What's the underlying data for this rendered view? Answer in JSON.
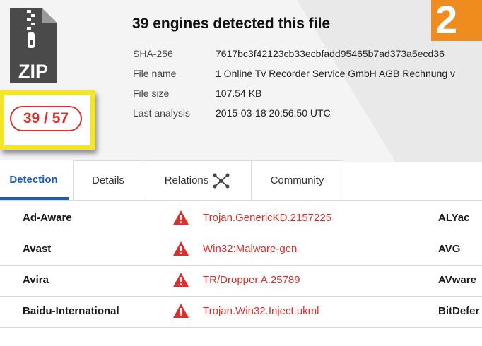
{
  "corner_number": "2",
  "file_icon": {
    "type": "ZIP"
  },
  "score": "39 / 57",
  "summary": {
    "title": "39 engines detected this file",
    "fields": [
      {
        "label": "SHA-256",
        "value": "7617bc3f42123cb33ecbfadd95465b7ad373a5ecd36"
      },
      {
        "label": "File name",
        "value": "1 Online Tv Recorder Service GmbH AGB Rechnung v"
      },
      {
        "label": "File size",
        "value": "107.54 KB"
      },
      {
        "label": "Last analysis",
        "value": "2015-03-18 20:56:50 UTC"
      }
    ]
  },
  "tabs": [
    {
      "label": "Detection",
      "active": true
    },
    {
      "label": "Details"
    },
    {
      "label": "Relations",
      "icon": "graph-icon"
    },
    {
      "label": "Community"
    }
  ],
  "detections": [
    {
      "engine": "Ad-Aware",
      "result": "Trojan.GenericKD.2157225",
      "engine2": "ALYac"
    },
    {
      "engine": "Avast",
      "result": "Win32:Malware-gen",
      "engine2": "AVG"
    },
    {
      "engine": "Avira",
      "result": "TR/Dropper.A.25789",
      "engine2": "AVware"
    },
    {
      "engine": "Baidu-International",
      "result": "Trojan.Win32.Inject.ukml",
      "engine2": "BitDefer"
    }
  ],
  "colors": {
    "accent": "#1a5cb6",
    "danger": "#d9302a",
    "highlight": "#f4e623",
    "badge": "#f08c1e"
  }
}
